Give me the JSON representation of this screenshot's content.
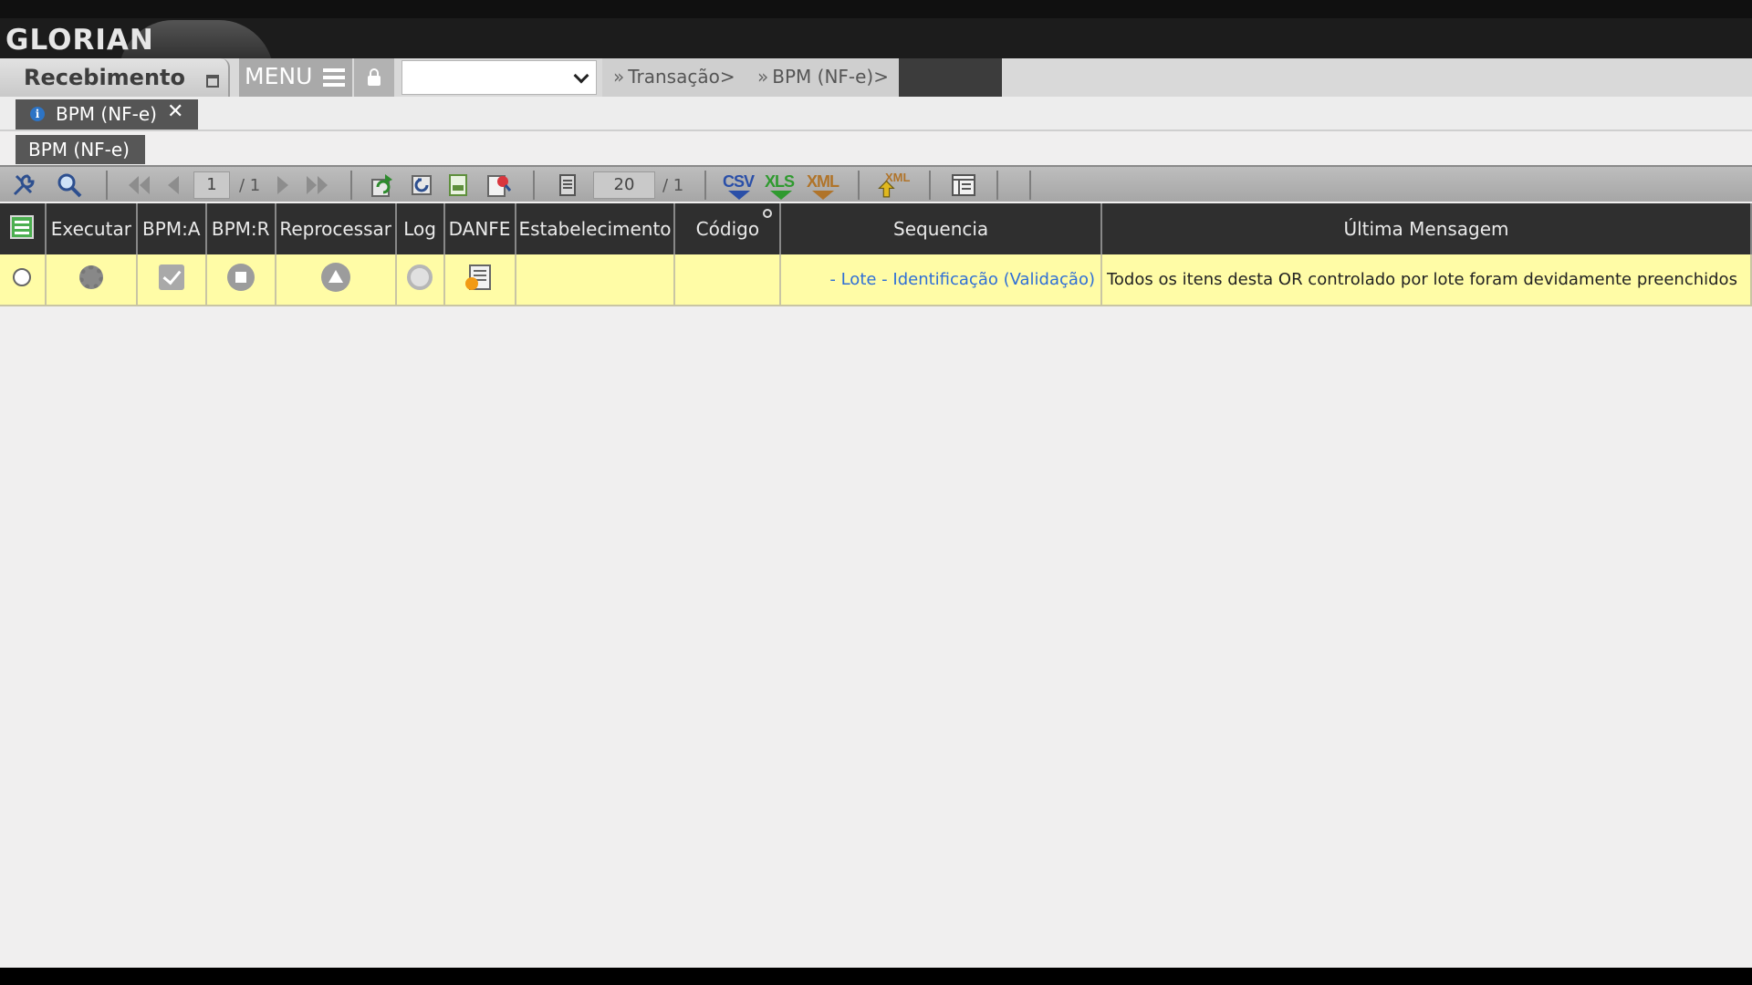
{
  "brand": {
    "logo_text": "GLORIAN"
  },
  "menubar": {
    "module_title": "Recebimento",
    "menu_label": "MENU",
    "select_value": "",
    "breadcrumbs": [
      "Transação>",
      "BPM (NF-e)>"
    ]
  },
  "open_tab": {
    "label": "BPM (NF-e)",
    "close": "✕"
  },
  "screen_title": "BPM (NF-e)",
  "toolbar": {
    "page_current": "1",
    "page_total": "/ 1",
    "rows_per_page": "20",
    "rows_total": "/ 1",
    "export_csv": "CSV",
    "export_xls": "XLS",
    "export_xml": "XML",
    "import_xml": "XML"
  },
  "grid": {
    "columns": [
      "Executar",
      "BPM:A",
      "BPM:R",
      "Reprocessar",
      "Log",
      "DANFE",
      "Estabelecimento",
      "Código",
      "Sequencia",
      "Última Mensagem"
    ],
    "rows": [
      {
        "estabelecimento": "",
        "codigo": "",
        "sequencia": "- Lote - Identificação (Validação)",
        "ultima_mensagem": "Todos os itens desta OR controlado por lote foram devidamente preenchidos"
      }
    ]
  },
  "colors": {
    "header_bg": "#2f2f2f",
    "row_highlight": "#fffca6",
    "link_blue": "#2f6fd6",
    "csv": "#2a4fa8",
    "xls": "#2f9a2f",
    "xml": "#b0742a"
  }
}
